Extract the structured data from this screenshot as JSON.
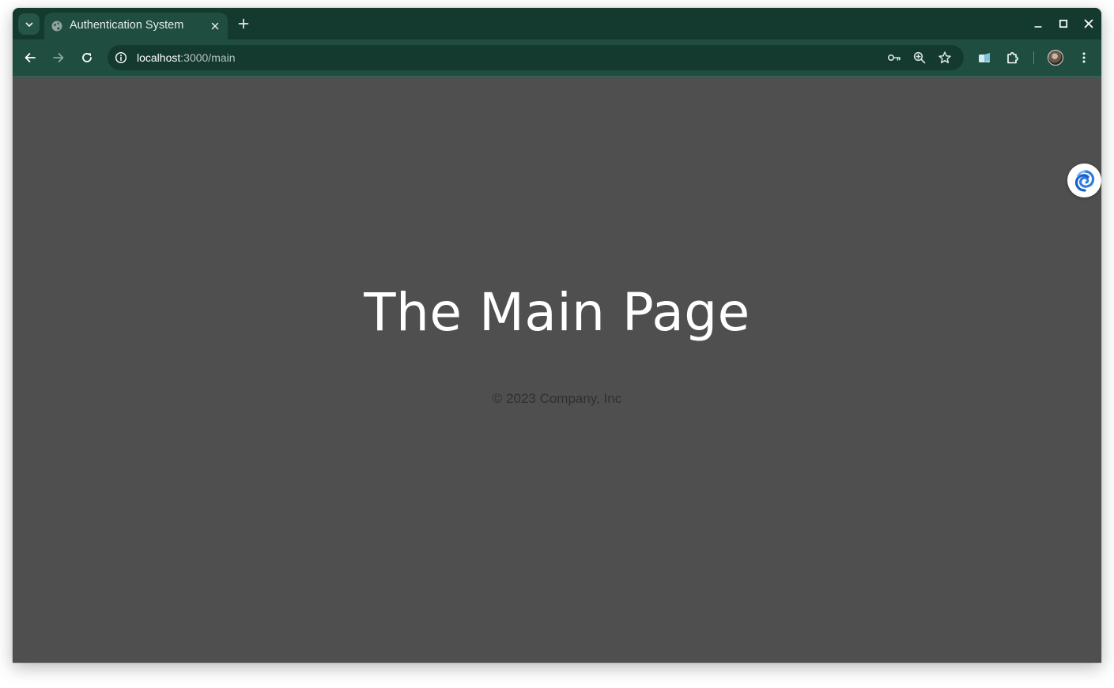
{
  "browser": {
    "tab": {
      "title": "Authentication System",
      "favicon": "globe-icon"
    },
    "address_bar": {
      "host": "localhost",
      "path": ":3000/main"
    },
    "icons": {
      "tab_search": "chevron-down-icon",
      "close_tab": "close-icon",
      "new_tab": "plus-icon",
      "minimize": "minimize-icon",
      "maximize": "maximize-icon",
      "close_window": "close-icon",
      "back": "arrow-left-icon",
      "forward": "arrow-right-icon",
      "reload": "reload-icon",
      "site_info": "info-icon",
      "passwords": "key-icon",
      "zoom": "zoom-in-icon",
      "bookmark": "star-icon",
      "extension": "extension-icon",
      "extensions_menu": "puzzle-icon",
      "profile": "avatar",
      "menu": "more-vert-icon"
    },
    "colors": {
      "tabstrip": "#143a30",
      "toolbar": "#1f4d40",
      "page_background": "#4f4f4f"
    }
  },
  "page": {
    "heading": "The Main Page",
    "footer": "© 2023 Company, Inc",
    "widget_icon": "swirl-icon"
  }
}
